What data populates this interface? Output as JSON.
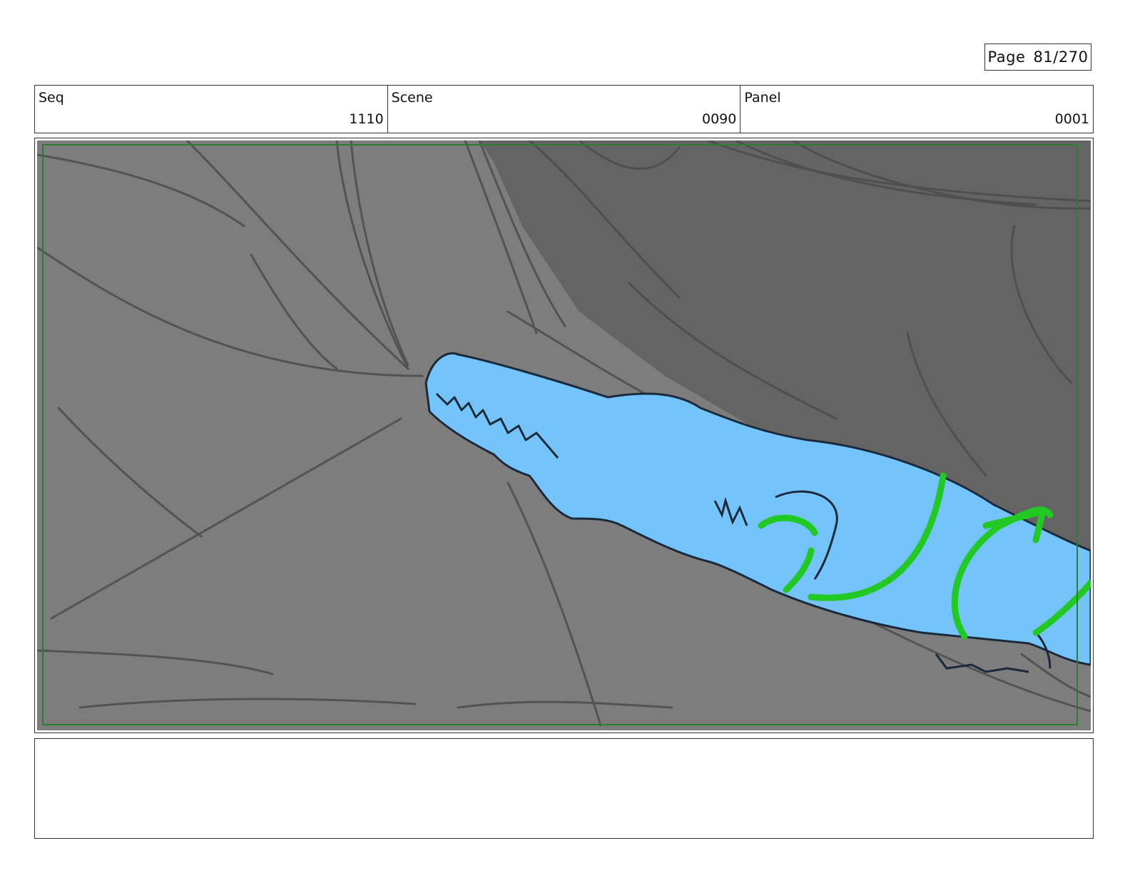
{
  "page": {
    "label": "Page 81/270"
  },
  "header": {
    "seq_label": "Seq",
    "seq_value": "1110",
    "scene_label": "Scene",
    "scene_value": "0090",
    "panel_label": "Panel",
    "panel_value": "0001"
  },
  "frame": {
    "description_icon": "crocodile-sketch",
    "colors": {
      "background_light": "#7d7d7d",
      "background_dark": "#646464",
      "creature": "#74c4fb",
      "highlight": "#22c922",
      "safe_frame": "#2e7d32"
    }
  },
  "notes": {
    "text": ""
  }
}
